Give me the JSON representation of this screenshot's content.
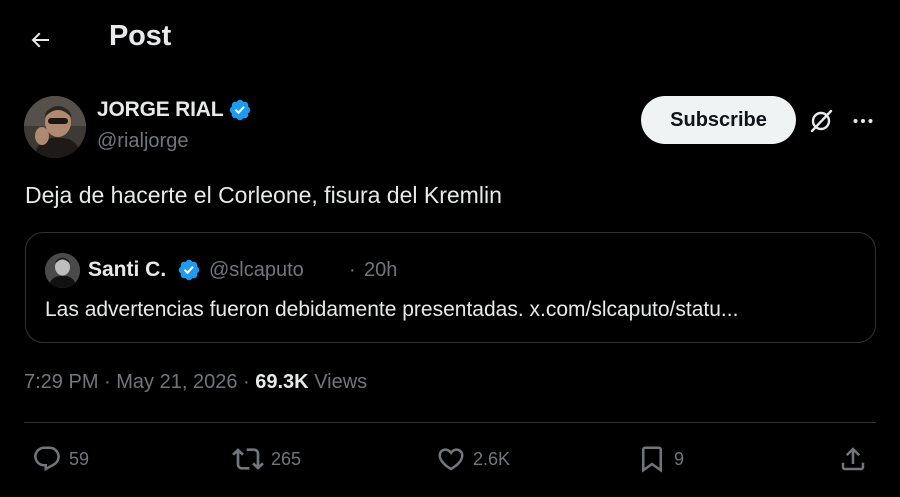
{
  "header": {
    "title": "Post",
    "back_icon": "arrow-left-icon"
  },
  "author": {
    "name": "JORGE RIAL",
    "handle": "@rialjorge",
    "verified": true,
    "badge_color": "#1d9bf0"
  },
  "actions_top": {
    "subscribe_label": "Subscribe",
    "grok_icon": "grok-icon",
    "more_icon": "more-horizontal-icon"
  },
  "post": {
    "text": "Deja de hacerte el Corleone, fisura del Kremlin"
  },
  "quote": {
    "name": "Santi C.",
    "handle": "@slcaputo",
    "separator": "·",
    "time": "20h",
    "verified": true,
    "text": "Las advertencias fueron debidamente presentadas. x.com/slcaputo/statu..."
  },
  "meta": {
    "time": "7:29 PM",
    "separator": " · ",
    "date": "May 21, 2026",
    "views_count": "69.3K",
    "views_label": "Views"
  },
  "engagement": {
    "replies": "59",
    "reposts": "265",
    "likes": "2.6K",
    "bookmarks": "9",
    "icons": [
      "reply-icon",
      "repost-icon",
      "like-icon",
      "bookmark-icon",
      "share-icon"
    ]
  },
  "colors": {
    "background": "#000000",
    "text_primary": "#e7e9ea",
    "text_secondary": "#71767b",
    "border": "#2f3336",
    "accent": "#1d9bf0",
    "subscribe_bg": "#eff3f4"
  }
}
